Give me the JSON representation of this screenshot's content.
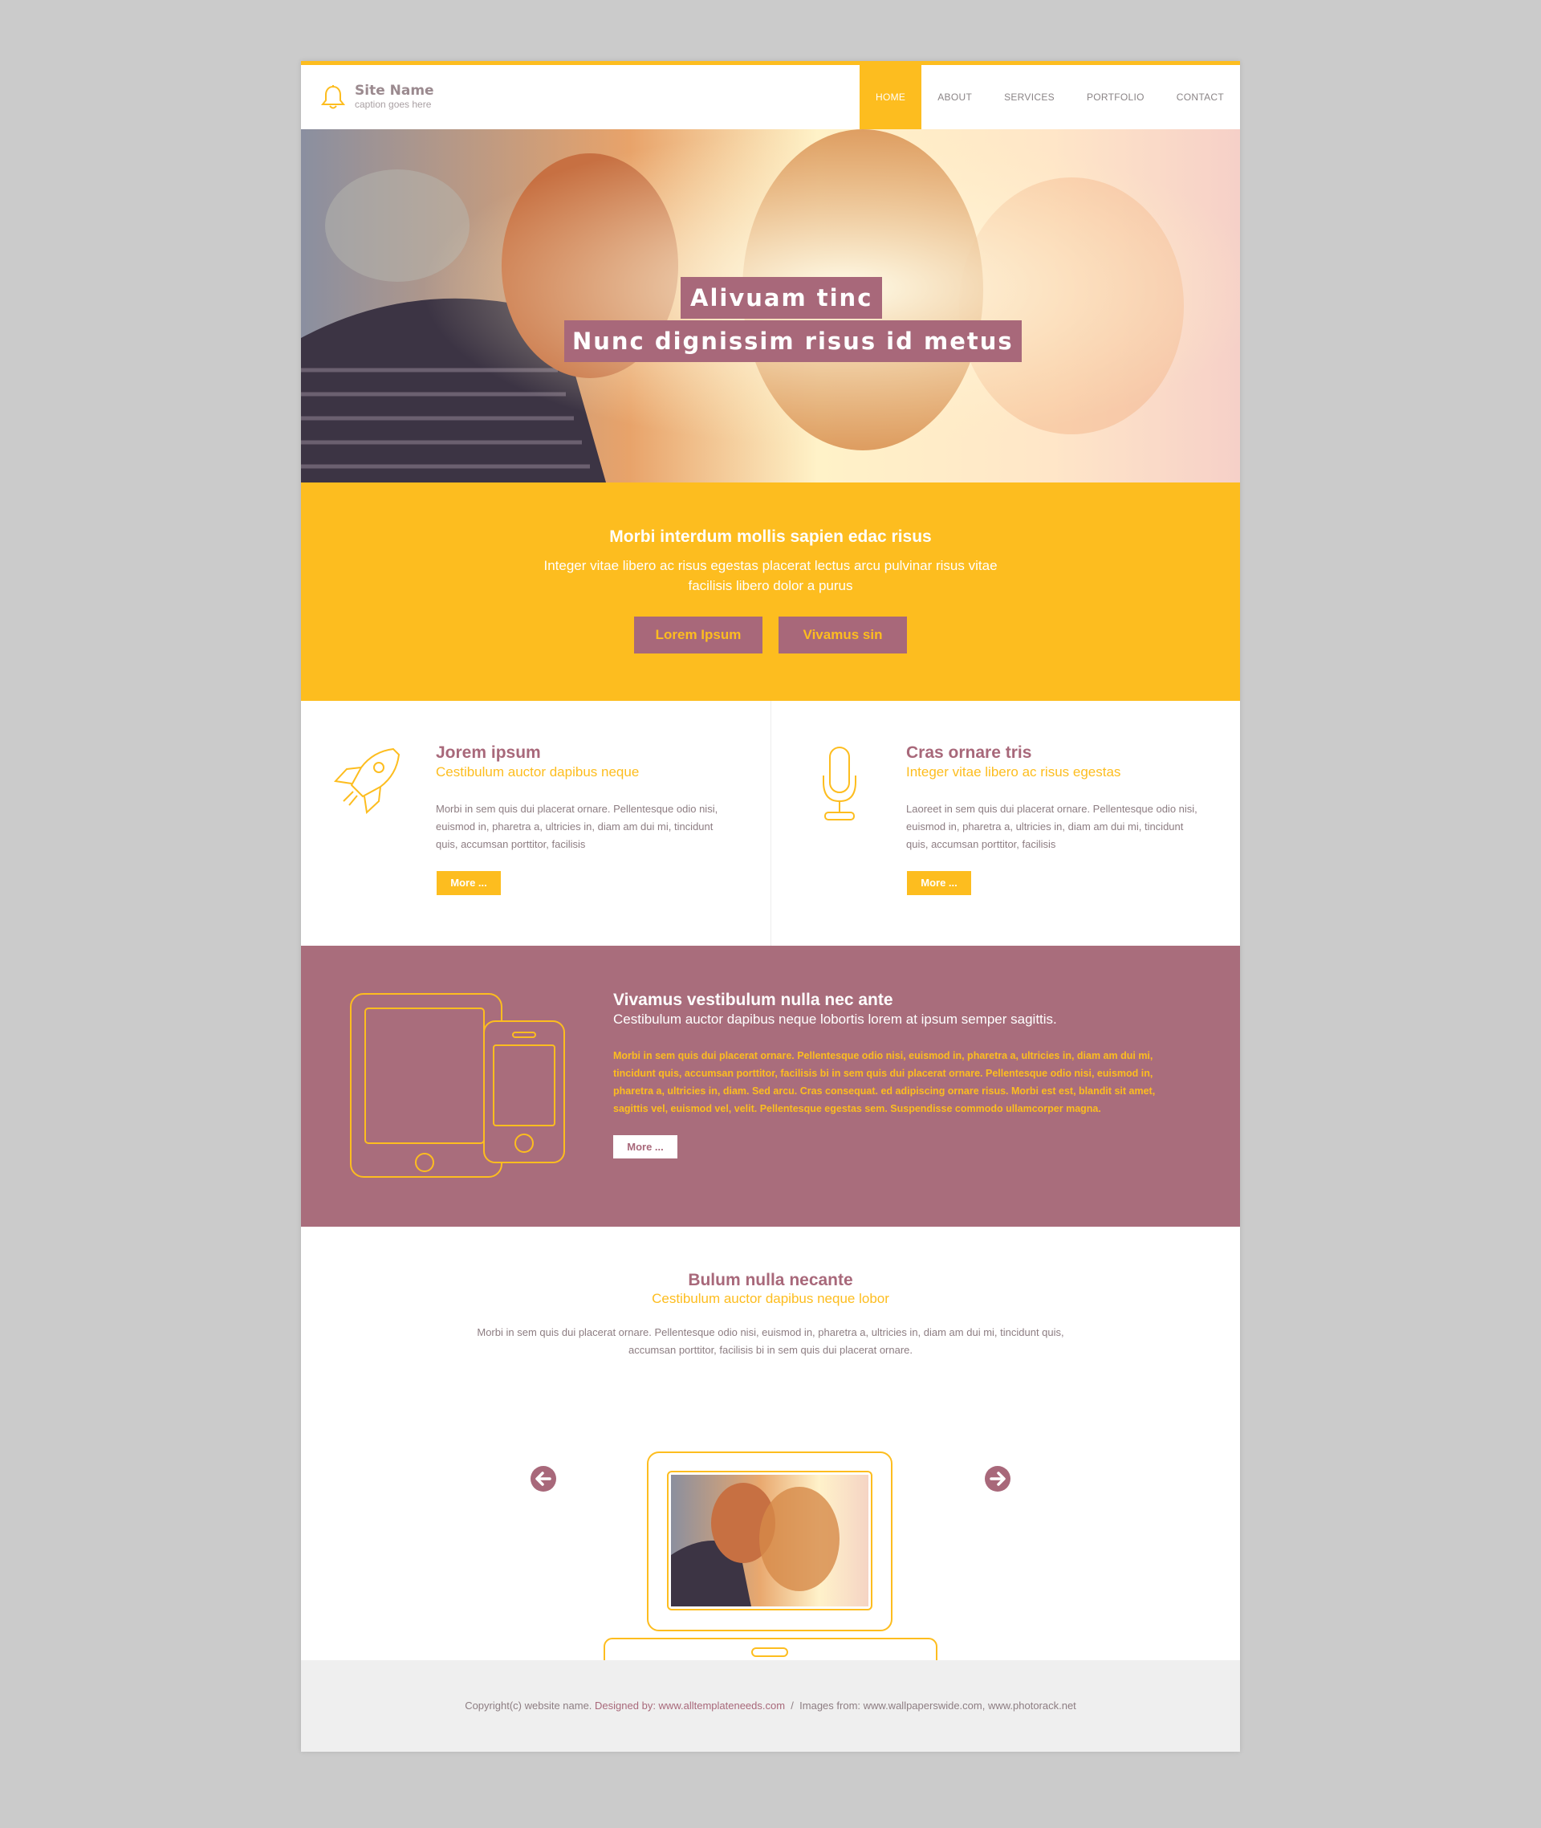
{
  "header": {
    "site_name": "Site Name",
    "caption": "caption goes here",
    "nav": [
      "HOME",
      "ABOUT",
      "SERVICES",
      "PORTFOLIO",
      "CONTACT"
    ],
    "active_nav": "HOME"
  },
  "hero": {
    "line1": "Alivuam tinc",
    "line2": "Nunc dignissim risus id metus"
  },
  "band": {
    "title": "Morbi interdum mollis sapien edac risus",
    "text": "Integer vitae libero ac risus egestas placerat lectus arcu pulvinar risus vitae facilisis libero dolor a purus",
    "button1": "Lorem Ipsum",
    "button2": "Vivamus sin"
  },
  "features": [
    {
      "icon": "rocket-icon",
      "title": "Jorem ipsum",
      "subtitle": "Cestibulum auctor dapibus neque",
      "text": "Morbi in sem quis dui placerat ornare. Pellentesque odio nisi, euismod in, pharetra a, ultricies in, diam am dui mi, tincidunt quis, accumsan porttitor, facilisis",
      "button": "More ..."
    },
    {
      "icon": "microphone-icon",
      "title": "Cras ornare tris",
      "subtitle": "Integer vitae libero ac risus egestas",
      "text": "Laoreet in sem quis dui placerat ornare. Pellentesque odio nisi, euismod in, pharetra a, ultricies in, diam am dui mi, tincidunt quis, accumsan porttitor, facilisis",
      "button": "More ..."
    }
  ],
  "showcase": {
    "title": "Vivamus vestibulum nulla nec ante",
    "subtitle": "Cestibulum auctor dapibus neque lobortis lorem at ipsum semper sagittis.",
    "text": "Morbi in sem quis dui placerat ornare. Pellentesque odio nisi, euismod in, pharetra a, ultricies in, diam am dui mi, tincidunt quis, accumsan porttitor, facilisis bi in sem quis dui placerat ornare. Pellentesque odio nisi, euismod in, pharetra a, ultricies in, diam. Sed arcu. Cras consequat. ed adipiscing ornare risus. Morbi est est, blandit sit amet, sagittis vel, euismod vel, velit. Pellentesque egestas sem. Suspendisse commodo ullamcorper magna.",
    "button": "More ..."
  },
  "portfolio": {
    "title": "Bulum nulla necante",
    "subtitle": "Cestibulum auctor dapibus neque lobor",
    "text": "Morbi in sem quis dui placerat ornare. Pellentesque odio nisi, euismod in, pharetra a, ultricies in, diam am dui mi, tincidunt quis, accumsan porttitor, facilisis bi in sem quis dui placerat ornare."
  },
  "footer": {
    "copyright": "Copyright(c) website name.",
    "designed_by": "Designed by: www.alltemplateneeds.com",
    "separator": "/",
    "images_from": "Images from: www.wallpaperswide.com, www.photorack.net"
  },
  "colors": {
    "accent": "#fdbd1f",
    "purple": "#a8687a",
    "background": "#cbcbcb"
  }
}
